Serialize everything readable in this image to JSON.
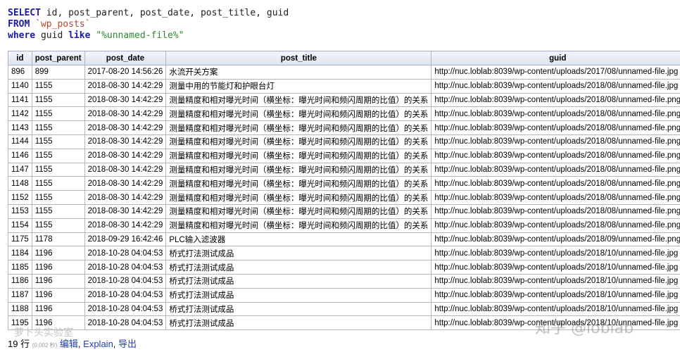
{
  "query": {
    "kw_select": "SELECT",
    "select_cols": " id, post_parent, post_date, post_title, guid",
    "kw_from": "FROM",
    "table": "`wp_posts`",
    "kw_where": "where",
    "where_col": " guid ",
    "kw_like": "like",
    "pattern": "\"%unnamed-file%\""
  },
  "columns": [
    "id",
    "post_parent",
    "post_date",
    "post_title",
    "guid"
  ],
  "rows": [
    [
      "896",
      "899",
      "2017-08-20 14:56:26",
      "水流开关方案",
      "http://nuc.loblab:8039/wp-content/uploads/2017/08/unnamed-file.jpg"
    ],
    [
      "1140",
      "1155",
      "2018-08-30 14:42:29",
      "测量中用的节能灯和护眼台灯",
      "http://nuc.loblab:8039/wp-content/uploads/2018/08/unnamed-file.jpg"
    ],
    [
      "1141",
      "1155",
      "2018-08-30 14:42:29",
      "测量精度和相对曝光时间（横坐标：曝光时间和频闪周期的比值）的关系",
      "http://nuc.loblab:8039/wp-content/uploads/2018/08/unnamed-file.png"
    ],
    [
      "1142",
      "1155",
      "2018-08-30 14:42:29",
      "测量精度和相对曝光时间（横坐标：曝光时间和频闪周期的比值）的关系",
      "http://nuc.loblab:8039/wp-content/uploads/2018/08/unnamed-file.png"
    ],
    [
      "1143",
      "1155",
      "2018-08-30 14:42:29",
      "测量精度和相对曝光时间（横坐标：曝光时间和频闪周期的比值）的关系",
      "http://nuc.loblab:8039/wp-content/uploads/2018/08/unnamed-file.png"
    ],
    [
      "1144",
      "1155",
      "2018-08-30 14:42:29",
      "测量精度和相对曝光时间（横坐标：曝光时间和频闪周期的比值）的关系",
      "http://nuc.loblab:8039/wp-content/uploads/2018/08/unnamed-file.png"
    ],
    [
      "1146",
      "1155",
      "2018-08-30 14:42:29",
      "测量精度和相对曝光时间（横坐标：曝光时间和频闪周期的比值）的关系",
      "http://nuc.loblab:8039/wp-content/uploads/2018/08/unnamed-file.png"
    ],
    [
      "1147",
      "1155",
      "2018-08-30 14:42:29",
      "测量精度和相对曝光时间（横坐标：曝光时间和频闪周期的比值）的关系",
      "http://nuc.loblab:8039/wp-content/uploads/2018/08/unnamed-file.png"
    ],
    [
      "1148",
      "1155",
      "2018-08-30 14:42:29",
      "测量精度和相对曝光时间（横坐标：曝光时间和频闪周期的比值）的关系",
      "http://nuc.loblab:8039/wp-content/uploads/2018/08/unnamed-file.png"
    ],
    [
      "1152",
      "1155",
      "2018-08-30 14:42:29",
      "测量精度和相对曝光时间（横坐标：曝光时间和频闪周期的比值）的关系",
      "http://nuc.loblab:8039/wp-content/uploads/2018/08/unnamed-file.png"
    ],
    [
      "1153",
      "1155",
      "2018-08-30 14:42:29",
      "测量精度和相对曝光时间（横坐标：曝光时间和频闪周期的比值）的关系",
      "http://nuc.loblab:8039/wp-content/uploads/2018/08/unnamed-file.png"
    ],
    [
      "1154",
      "1155",
      "2018-08-30 14:42:29",
      "测量精度和相对曝光时间（横坐标：曝光时间和频闪周期的比值）的关系",
      "http://nuc.loblab:8039/wp-content/uploads/2018/08/unnamed-file.png"
    ],
    [
      "1175",
      "1178",
      "2018-09-29 16:42:46",
      "PLC输入滤波器",
      "http://nuc.loblab:8039/wp-content/uploads/2018/09/unnamed-file.png"
    ],
    [
      "1184",
      "1196",
      "2018-10-28 04:04:53",
      "桥式打法测试成品",
      "http://nuc.loblab:8039/wp-content/uploads/2018/10/unnamed-file.jpg"
    ],
    [
      "1185",
      "1196",
      "2018-10-28 04:04:53",
      "桥式打法测试成品",
      "http://nuc.loblab:8039/wp-content/uploads/2018/10/unnamed-file.jpg"
    ],
    [
      "1186",
      "1196",
      "2018-10-28 04:04:53",
      "桥式打法测试成品",
      "http://nuc.loblab:8039/wp-content/uploads/2018/10/unnamed-file.jpg"
    ],
    [
      "1187",
      "1196",
      "2018-10-28 04:04:53",
      "桥式打法测试成品",
      "http://nuc.loblab:8039/wp-content/uploads/2018/10/unnamed-file.jpg"
    ],
    [
      "1188",
      "1196",
      "2018-10-28 04:04:53",
      "桥式打法测试成品",
      "http://nuc.loblab:8039/wp-content/uploads/2018/10/unnamed-file.jpg"
    ],
    [
      "1195",
      "1196",
      "2018-10-28 04:04:53",
      "桥式打法测试成品",
      "http://nuc.loblab:8039/wp-content/uploads/2018/10/unnamed-file.jpg"
    ]
  ],
  "footer": {
    "row_count": "19 行",
    "timing": "(0.002 秒)",
    "edit_link": "编辑",
    "sep1": ", ",
    "explain_link": "Explain",
    "sep2": ", ",
    "export_link": "导出"
  },
  "watermarks": {
    "left": "萝卜头实验室",
    "right": "知乎 @loblab"
  },
  "colors": {
    "keyword": "#1a1aa6",
    "table_name": "#b5452a",
    "string_literal": "#2d8a2d",
    "link": "#1f3fa8"
  }
}
